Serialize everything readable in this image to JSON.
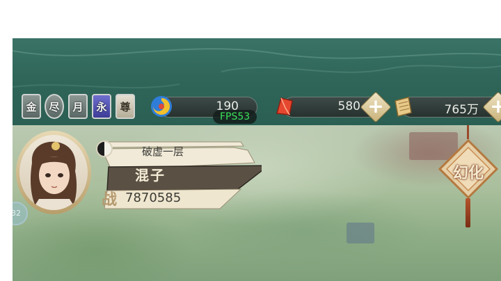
{
  "hud": {
    "badges": [
      {
        "label": "金",
        "icon": "gold-badge-icon"
      },
      {
        "label": "尽",
        "icon": "leaf-badge-icon"
      },
      {
        "label": "月",
        "icon": "moon-badge-icon"
      },
      {
        "label": "永",
        "icon": "eternal-badge-icon"
      },
      {
        "label": "尊",
        "icon": "honor-badge-icon"
      }
    ],
    "stamina_value": "190",
    "fps_text": "FPS53",
    "gem_value": "580",
    "coin_value": "765万",
    "colors": {
      "topbar": "#2f6659",
      "fps": "#3be35a",
      "pill": "#27322f",
      "plus": "#c9b27a"
    }
  },
  "player": {
    "realm": "破虚一层",
    "name": "混子",
    "power_label": "战",
    "power": "7870585",
    "side_button": "32"
  },
  "huanhua": {
    "label": "幻化"
  }
}
